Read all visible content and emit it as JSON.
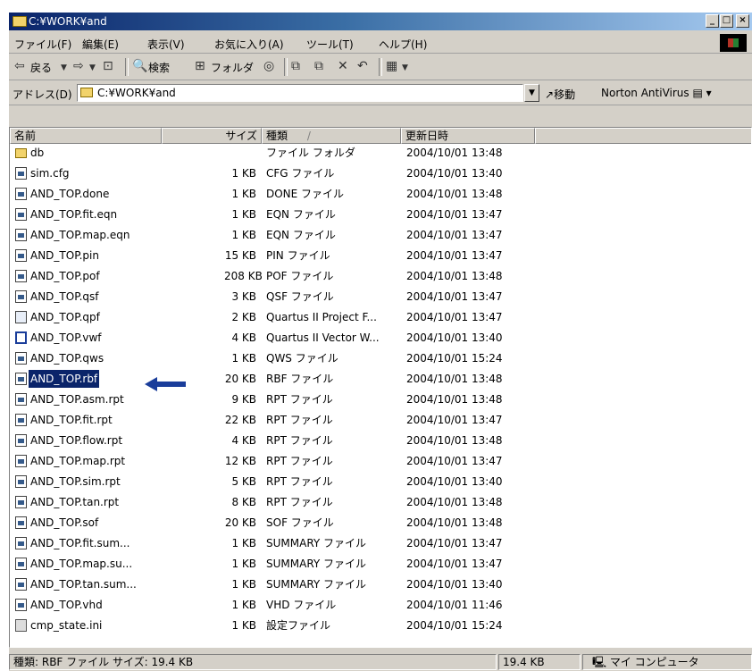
{
  "window": {
    "title": "C:¥WORK¥and"
  },
  "menu": [
    "ファイル(F)",
    "編集(E)",
    "表示(V)",
    "お気に入り(A)",
    "ツール(T)",
    "ヘルプ(H)"
  ],
  "toolbar": {
    "back": "戻る",
    "search": "検索",
    "folders": "フォルダ"
  },
  "address": {
    "label": "アドレス(D)",
    "value": "C:¥WORK¥and",
    "go": "移動",
    "norton": "Norton AntiVirus"
  },
  "columns": {
    "name": "名前",
    "size": "サイズ",
    "type": "種類",
    "sort_marker": "/",
    "date": "更新日時"
  },
  "files": [
    {
      "name": "db",
      "size": "",
      "type": "ファイル フォルダ",
      "date": "2004/10/01 13:48",
      "icon": "folder-icon"
    },
    {
      "name": "sim.cfg",
      "size": "1 KB",
      "type": "CFG ファイル",
      "date": "2004/10/01 13:40",
      "icon": "file-icon"
    },
    {
      "name": "AND_TOP.done",
      "size": "1 KB",
      "type": "DONE ファイル",
      "date": "2004/10/01 13:48",
      "icon": "file-icon"
    },
    {
      "name": "AND_TOP.fit.eqn",
      "size": "1 KB",
      "type": "EQN ファイル",
      "date": "2004/10/01 13:47",
      "icon": "file-icon"
    },
    {
      "name": "AND_TOP.map.eqn",
      "size": "1 KB",
      "type": "EQN ファイル",
      "date": "2004/10/01 13:47",
      "icon": "file-icon"
    },
    {
      "name": "AND_TOP.pin",
      "size": "15 KB",
      "type": "PIN ファイル",
      "date": "2004/10/01 13:47",
      "icon": "file-icon"
    },
    {
      "name": "AND_TOP.pof",
      "size": "208 KB",
      "type": "POF ファイル",
      "date": "2004/10/01 13:48",
      "icon": "file-icon"
    },
    {
      "name": "AND_TOP.qsf",
      "size": "3 KB",
      "type": "QSF ファイル",
      "date": "2004/10/01 13:47",
      "icon": "file-icon"
    },
    {
      "name": "AND_TOP.qpf",
      "size": "2 KB",
      "type": "Quartus II Project F...",
      "date": "2004/10/01 13:47",
      "icon": "quartus-project-icon"
    },
    {
      "name": "AND_TOP.vwf",
      "size": "4 KB",
      "type": "Quartus II Vector W...",
      "date": "2004/10/01 13:40",
      "icon": "waveform-icon"
    },
    {
      "name": "AND_TOP.qws",
      "size": "1 KB",
      "type": "QWS ファイル",
      "date": "2004/10/01 15:24",
      "icon": "file-icon"
    },
    {
      "name": "AND_TOP.rbf",
      "size": "20 KB",
      "type": "RBF ファイル",
      "date": "2004/10/01 13:48",
      "icon": "file-icon",
      "selected": true
    },
    {
      "name": "AND_TOP.asm.rpt",
      "size": "9 KB",
      "type": "RPT ファイル",
      "date": "2004/10/01 13:48",
      "icon": "file-icon"
    },
    {
      "name": "AND_TOP.fit.rpt",
      "size": "22 KB",
      "type": "RPT ファイル",
      "date": "2004/10/01 13:47",
      "icon": "file-icon"
    },
    {
      "name": "AND_TOP.flow.rpt",
      "size": "4 KB",
      "type": "RPT ファイル",
      "date": "2004/10/01 13:48",
      "icon": "file-icon"
    },
    {
      "name": "AND_TOP.map.rpt",
      "size": "12 KB",
      "type": "RPT ファイル",
      "date": "2004/10/01 13:47",
      "icon": "file-icon"
    },
    {
      "name": "AND_TOP.sim.rpt",
      "size": "5 KB",
      "type": "RPT ファイル",
      "date": "2004/10/01 13:40",
      "icon": "file-icon"
    },
    {
      "name": "AND_TOP.tan.rpt",
      "size": "8 KB",
      "type": "RPT ファイル",
      "date": "2004/10/01 13:48",
      "icon": "file-icon"
    },
    {
      "name": "AND_TOP.sof",
      "size": "20 KB",
      "type": "SOF ファイル",
      "date": "2004/10/01 13:48",
      "icon": "file-icon"
    },
    {
      "name": "AND_TOP.fit.sum...",
      "size": "1 KB",
      "type": "SUMMARY ファイル",
      "date": "2004/10/01 13:47",
      "icon": "file-icon"
    },
    {
      "name": "AND_TOP.map.su...",
      "size": "1 KB",
      "type": "SUMMARY ファイル",
      "date": "2004/10/01 13:47",
      "icon": "file-icon"
    },
    {
      "name": "AND_TOP.tan.sum...",
      "size": "1 KB",
      "type": "SUMMARY ファイル",
      "date": "2004/10/01 13:40",
      "icon": "file-icon"
    },
    {
      "name": "AND_TOP.vhd",
      "size": "1 KB",
      "type": "VHD ファイル",
      "date": "2004/10/01 11:46",
      "icon": "file-icon"
    },
    {
      "name": "cmp_state.ini",
      "size": "1 KB",
      "type": "設定ファイル",
      "date": "2004/10/01 15:24",
      "icon": "settings-file-icon"
    }
  ],
  "status": {
    "left": "種類: RBF ファイル サイズ: 19.4 KB",
    "size": "19.4 KB",
    "location": "マイ コンピュータ"
  },
  "colors": {
    "title_start": "#0a246a",
    "title_end": "#a6caf0",
    "selection": "#0a246a",
    "face": "#d4d0c8",
    "arrow": "#1a3d9a"
  }
}
